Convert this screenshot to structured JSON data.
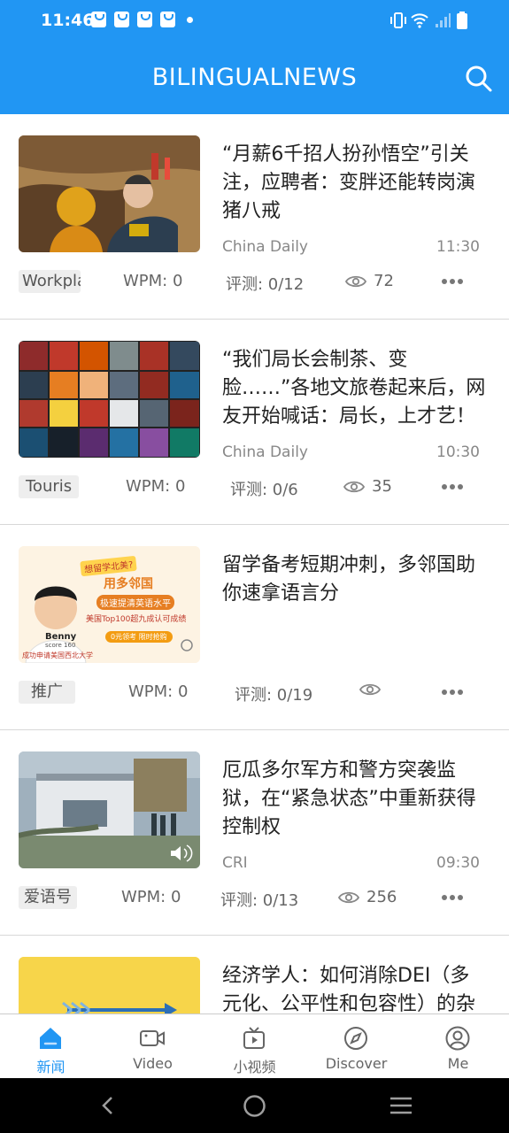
{
  "status_bar": {
    "time": "11:46"
  },
  "app_bar": {
    "title": "BILINGUALNEWS"
  },
  "articles": [
    {
      "headline": "“月薪6千招人扮孙悟空”引关注，应聘者：变胖还能转岗演猪八戒",
      "source": "China Daily",
      "time": "11:30",
      "tag": "Workpla",
      "wpm": "WPM: 0",
      "test": "评测: 0/12",
      "views": "72"
    },
    {
      "headline": "“我们局长会制茶、变脸……”各地文旅卷起来后，网友开始喊话：局长，上才艺！",
      "source": "China Daily",
      "time": "10:30",
      "tag": "Touris",
      "wpm": "WPM: 0",
      "test": "评测: 0/6",
      "views": "35"
    },
    {
      "headline": "留学备考短期冲刺，多邻国助你速拿语言分",
      "source": "",
      "time": "",
      "tag": "推广",
      "wpm": "WPM: 0",
      "test": "评测: 0/19",
      "views": "",
      "ad": {
        "badge": "想留学北美?",
        "line1": "用多邻国",
        "line2": "极速提清英语水平",
        "line3": "美国Top100超九成认可成绩",
        "cta": "0元领考 限时抢购",
        "name": "Benny",
        "score": "score 160",
        "caption": "成功申请美国西北大学"
      }
    },
    {
      "headline": "厄瓜多尔军方和警方突袭监狱，在“紧急状态”中重新获得控制权",
      "source": "CRI",
      "time": "09:30",
      "tag": "爱语号",
      "wpm": "WPM: 0",
      "test": "评测: 0/13",
      "views": "256"
    },
    {
      "headline": "经济学人：如何消除DEI（多元化、公平性和包容性）的杂音",
      "source": "",
      "time": "",
      "tag": "",
      "wpm": "",
      "test": "",
      "views": ""
    }
  ],
  "tabs": [
    {
      "label": "新闻",
      "icon": "home-icon",
      "active": true
    },
    {
      "label": "Video",
      "icon": "video-camera-icon",
      "active": false
    },
    {
      "label": "小视频",
      "icon": "tv-play-icon",
      "active": false
    },
    {
      "label": "Discover",
      "icon": "compass-icon",
      "active": false
    },
    {
      "label": "Me",
      "icon": "user-icon",
      "active": false
    }
  ],
  "colors": {
    "primary": "#2196f3",
    "text": "#222222",
    "muted": "#888888",
    "tag_bg": "#eeeeee"
  }
}
